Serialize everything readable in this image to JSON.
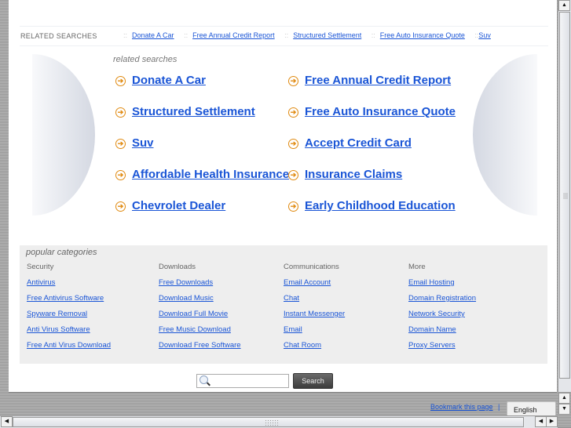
{
  "related_bar": {
    "label": "RELATED SEARCHES",
    "separator": "::",
    "links": [
      "Donate A Car",
      "Free Annual Credit Report",
      "Structured Settlement",
      "Free Auto Insurance Quote",
      "Suv"
    ]
  },
  "related_heading": "related searches",
  "related_links": {
    "left": [
      "Donate A Car",
      "Structured Settlement",
      "Suv",
      "Affordable Health Insurance",
      "Chevrolet Dealer"
    ],
    "right": [
      "Free Annual Credit Report",
      "Free Auto Insurance Quote",
      "Accept Credit Card",
      "Insurance Claims",
      "Early Childhood Education"
    ]
  },
  "arrow_icon": "➔",
  "popular": {
    "title": "popular categories",
    "columns": [
      {
        "heading": "Security",
        "links": [
          "Antivirus",
          "Free Antivirus Software",
          "Spyware Removal",
          "Anti Virus Software",
          "Free Anti Virus Download"
        ]
      },
      {
        "heading": "Downloads",
        "links": [
          "Free Downloads",
          "Download Music",
          "Download Full Movie",
          "Free Music Download",
          "Download Free Software"
        ]
      },
      {
        "heading": "Communications",
        "links": [
          "Email Account",
          "Chat",
          "Instant Messenger",
          "Email",
          "Chat Room"
        ]
      },
      {
        "heading": "More",
        "links": [
          "Email Hosting",
          "Domain Registration",
          "Network Security",
          "Domain Name",
          "Proxy Servers"
        ]
      }
    ]
  },
  "search": {
    "input_value": "",
    "button_label": "Search"
  },
  "footer": {
    "bookmark_label": "Bookmark this page",
    "bookmark_sep": "|",
    "language": "English"
  },
  "scroll_glyphs": {
    "up": "▲",
    "down": "▼",
    "left": "◀",
    "right": "▶"
  },
  "colors": {
    "link": "#1a55d6",
    "arrow": "#e08a10",
    "panel_bg": "#eeeeee"
  }
}
